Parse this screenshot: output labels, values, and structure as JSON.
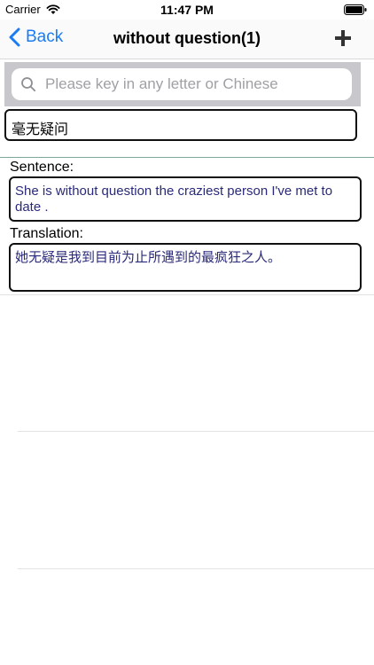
{
  "status_bar": {
    "carrier": "Carrier",
    "time": "11:47 PM",
    "wifi_icon": "wifi-icon",
    "battery_icon": "battery-icon"
  },
  "nav": {
    "back_label": "Back",
    "title": "without question(1)",
    "add_icon": "plus-icon",
    "accent_color": "#1a7cf5"
  },
  "search": {
    "placeholder": "Please key in any letter or Chinese",
    "value": ""
  },
  "entry": {
    "meaning": "毫无疑问",
    "sentence_label": "Sentence:",
    "sentence": "She is without question the craziest person I've met to date .",
    "translation_label": "Translation:",
    "translation": "她无疑是我到目前为止所遇到的最疯狂之人。",
    "text_color": "#2a2a7a"
  }
}
